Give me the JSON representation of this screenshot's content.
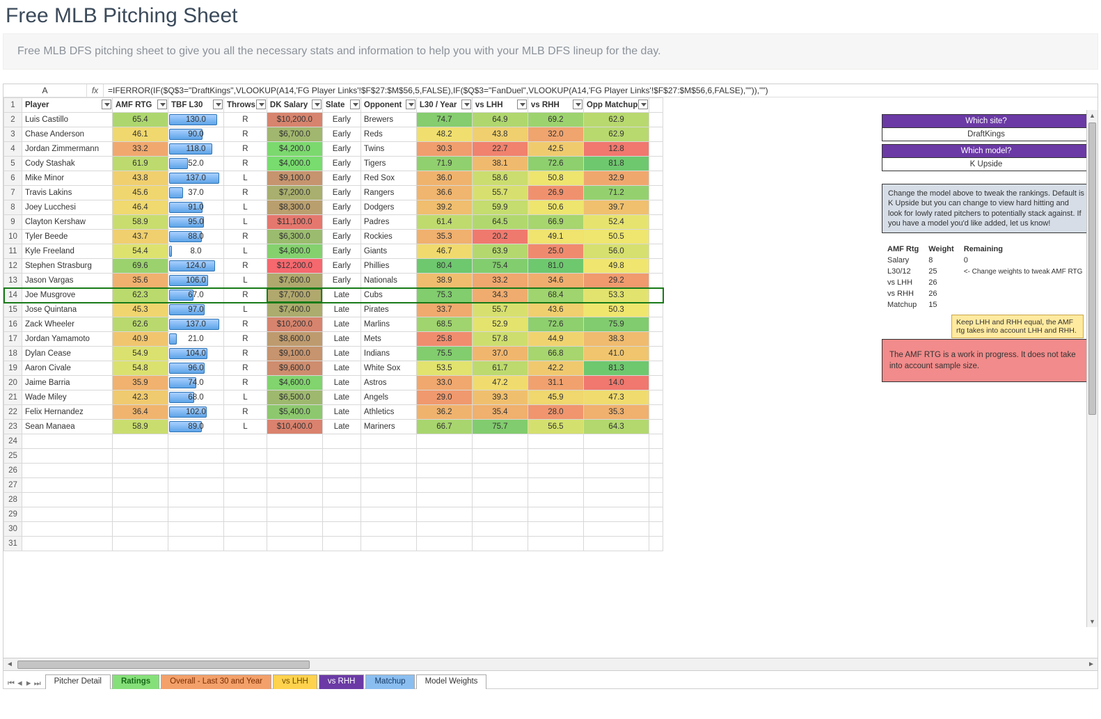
{
  "header": {
    "title": "Free MLB Pitching Sheet",
    "subtitle": "Free MLB DFS pitching sheet to give you all the necessary stats and information to help you with your MLB DFS lineup for the day."
  },
  "formula_bar": {
    "cell_ref": "A",
    "fx": "fx",
    "formula": "=IFERROR(IF($Q$3=\"DraftKings\",VLOOKUP(A14,'FG Player Links'!$F$27:$M$56,5,FALSE),IF($Q$3=\"FanDuel\",VLOOKUP(A14,'FG Player Links'!$F$27:$M$56,6,FALSE),\"\")),\"\")"
  },
  "columns": [
    "Player",
    "AMF RTG",
    "TBF L30",
    "Throws",
    "DK Salary",
    "Slate",
    "Opponent",
    "L30 / Year",
    "vs LHH",
    "vs RHH",
    "Opp Matchup"
  ],
  "selected_row_index": 12,
  "max_tbf": 140,
  "rows": [
    {
      "player": "Luis Castillo",
      "amf": 65.4,
      "tbf": 130.0,
      "throws": "R",
      "salary": "$10,200.0",
      "slate": "Early",
      "opp": "Brewers",
      "l30": 74.7,
      "lhh": 64.9,
      "rhh": 69.2,
      "match": 62.9
    },
    {
      "player": "Chase Anderson",
      "amf": 46.1,
      "tbf": 90.0,
      "throws": "R",
      "salary": "$6,700.0",
      "slate": "Early",
      "opp": "Reds",
      "l30": 48.2,
      "lhh": 43.8,
      "rhh": 32.0,
      "match": 62.9
    },
    {
      "player": "Jordan Zimmermann",
      "amf": 33.2,
      "tbf": 118.0,
      "throws": "R",
      "salary": "$4,200.0",
      "slate": "Early",
      "opp": "Twins",
      "l30": 30.3,
      "lhh": 22.7,
      "rhh": 42.5,
      "match": 12.8
    },
    {
      "player": "Cody Stashak",
      "amf": 61.9,
      "tbf": 52.0,
      "throws": "R",
      "salary": "$4,000.0",
      "slate": "Early",
      "opp": "Tigers",
      "l30": 71.9,
      "lhh": 38.1,
      "rhh": 72.6,
      "match": 81.8
    },
    {
      "player": "Mike Minor",
      "amf": 43.8,
      "tbf": 137.0,
      "throws": "L",
      "salary": "$9,100.0",
      "slate": "Early",
      "opp": "Red Sox",
      "l30": 36.0,
      "lhh": 58.6,
      "rhh": 50.8,
      "match": 32.9
    },
    {
      "player": "Travis Lakins",
      "amf": 45.6,
      "tbf": 37.0,
      "throws": "R",
      "salary": "$7,200.0",
      "slate": "Early",
      "opp": "Rangers",
      "l30": 36.6,
      "lhh": 55.7,
      "rhh": 26.9,
      "match": 71.2
    },
    {
      "player": "Joey Lucchesi",
      "amf": 46.4,
      "tbf": 91.0,
      "throws": "L",
      "salary": "$8,300.0",
      "slate": "Early",
      "opp": "Dodgers",
      "l30": 39.2,
      "lhh": 59.9,
      "rhh": 50.6,
      "match": 39.7
    },
    {
      "player": "Clayton Kershaw",
      "amf": 58.9,
      "tbf": 95.0,
      "throws": "L",
      "salary": "$11,100.0",
      "slate": "Early",
      "opp": "Padres",
      "l30": 61.4,
      "lhh": 64.5,
      "rhh": 66.9,
      "match": 52.4
    },
    {
      "player": "Tyler Beede",
      "amf": 43.7,
      "tbf": 88.0,
      "throws": "R",
      "salary": "$6,300.0",
      "slate": "Early",
      "opp": "Rockies",
      "l30": 35.3,
      "lhh": 20.2,
      "rhh": 49.1,
      "match": 50.5
    },
    {
      "player": "Kyle Freeland",
      "amf": 54.4,
      "tbf": 8.0,
      "throws": "L",
      "salary": "$4,800.0",
      "slate": "Early",
      "opp": "Giants",
      "l30": 46.7,
      "lhh": 63.9,
      "rhh": 25.0,
      "match": 56.0
    },
    {
      "player": "Stephen Strasburg",
      "amf": 69.6,
      "tbf": 124.0,
      "throws": "R",
      "salary": "$12,200.0",
      "slate": "Early",
      "opp": "Phillies",
      "l30": 80.4,
      "lhh": 75.4,
      "rhh": 81.0,
      "match": 49.8
    },
    {
      "player": "Jason Vargas",
      "amf": 35.6,
      "tbf": 106.0,
      "throws": "L",
      "salary": "$7,600.0",
      "slate": "Early",
      "opp": "Nationals",
      "l30": 38.9,
      "lhh": 33.2,
      "rhh": 34.6,
      "match": 29.2
    },
    {
      "player": "Joe Musgrove",
      "amf": 62.3,
      "tbf": 67.0,
      "throws": "R",
      "salary": "$7,700.0",
      "slate": "Late",
      "opp": "Cubs",
      "l30": 75.3,
      "lhh": 34.3,
      "rhh": 68.4,
      "match": 53.3
    },
    {
      "player": "Jose Quintana",
      "amf": 45.3,
      "tbf": 97.0,
      "throws": "L",
      "salary": "$7,400.0",
      "slate": "Late",
      "opp": "Pirates",
      "l30": 33.7,
      "lhh": 55.7,
      "rhh": 43.6,
      "match": 50.3
    },
    {
      "player": "Zack Wheeler",
      "amf": 62.6,
      "tbf": 137.0,
      "throws": "R",
      "salary": "$10,200.0",
      "slate": "Late",
      "opp": "Marlins",
      "l30": 68.5,
      "lhh": 52.9,
      "rhh": 72.6,
      "match": 75.9
    },
    {
      "player": "Jordan Yamamoto",
      "amf": 40.9,
      "tbf": 21.0,
      "throws": "R",
      "salary": "$8,600.0",
      "slate": "Late",
      "opp": "Mets",
      "l30": 25.8,
      "lhh": 57.8,
      "rhh": 44.9,
      "match": 38.3
    },
    {
      "player": "Dylan Cease",
      "amf": 54.9,
      "tbf": 104.0,
      "throws": "R",
      "salary": "$9,100.0",
      "slate": "Late",
      "opp": "Indians",
      "l30": 75.5,
      "lhh": 37.0,
      "rhh": 66.8,
      "match": 41.0
    },
    {
      "player": "Aaron Civale",
      "amf": 54.8,
      "tbf": 96.0,
      "throws": "R",
      "salary": "$9,600.0",
      "slate": "Late",
      "opp": "White Sox",
      "l30": 53.5,
      "lhh": 61.7,
      "rhh": 42.2,
      "match": 81.3
    },
    {
      "player": "Jaime Barria",
      "amf": 35.9,
      "tbf": 74.0,
      "throws": "R",
      "salary": "$4,600.0",
      "slate": "Late",
      "opp": "Astros",
      "l30": 33.0,
      "lhh": 47.2,
      "rhh": 31.1,
      "match": 14.0
    },
    {
      "player": "Wade Miley",
      "amf": 42.3,
      "tbf": 68.0,
      "throws": "L",
      "salary": "$6,500.0",
      "slate": "Late",
      "opp": "Angels",
      "l30": 29.0,
      "lhh": 39.3,
      "rhh": 45.9,
      "match": 47.3
    },
    {
      "player": "Felix Hernandez",
      "amf": 36.4,
      "tbf": 102.0,
      "throws": "R",
      "salary": "$5,400.0",
      "slate": "Late",
      "opp": "Athletics",
      "l30": 36.2,
      "lhh": 35.4,
      "rhh": 28.0,
      "match": 35.3
    },
    {
      "player": "Sean Manaea",
      "amf": 58.9,
      "tbf": 89.0,
      "throws": "L",
      "salary": "$10,400.0",
      "slate": "Late",
      "opp": "Mariners",
      "l30": 66.7,
      "lhh": 75.7,
      "rhh": 56.5,
      "match": 64.3
    }
  ],
  "side": {
    "site_label": "Which site?",
    "site_value": "DraftKings",
    "model_label": "Which model?",
    "model_value": "K Upside",
    "info_text": "Change the model above to tweak the rankings. Default is K Upside but you can change to view hard hitting and look for lowly rated pitchers to potentially stack against. If you have a model you'd like added, let us know!",
    "weights_header": [
      "AMF Rtg",
      "Weight",
      "Remaining"
    ],
    "weights": [
      {
        "k": "Salary",
        "w": "8",
        "r": "0"
      },
      {
        "k": "L30/12",
        "w": "25",
        "r": "<- Change weights to tweak AMF RTG"
      },
      {
        "k": "vs LHH",
        "w": "26",
        "r": ""
      },
      {
        "k": "vs RHH",
        "w": "26",
        "r": ""
      },
      {
        "k": "Matchup",
        "w": "15",
        "r": ""
      }
    ],
    "note_text": "Keep LHH and RHH equal, the AMF rtg takes into account LHH and RHH.",
    "warn_text": "The AMF RTG is a work in progress. It does not take into account sample size."
  },
  "tabs": [
    {
      "label": "Pitcher Detail",
      "bg": "#ffffff",
      "fg": "#333"
    },
    {
      "label": "Ratings",
      "bg": "#86e07a",
      "fg": "#186a18",
      "active": true
    },
    {
      "label": "Overall - Last 30 and Year",
      "bg": "#f3a06a",
      "fg": "#7a2d00"
    },
    {
      "label": "vs LHH",
      "bg": "#ffd24d",
      "fg": "#6b4a00"
    },
    {
      "label": "vs RHH",
      "bg": "#6b3aa5",
      "fg": "#ffffff"
    },
    {
      "label": "Matchup",
      "bg": "#8bbef0",
      "fg": "#163b66"
    },
    {
      "label": "Model Weights",
      "bg": "#ffffff",
      "fg": "#333"
    }
  ]
}
